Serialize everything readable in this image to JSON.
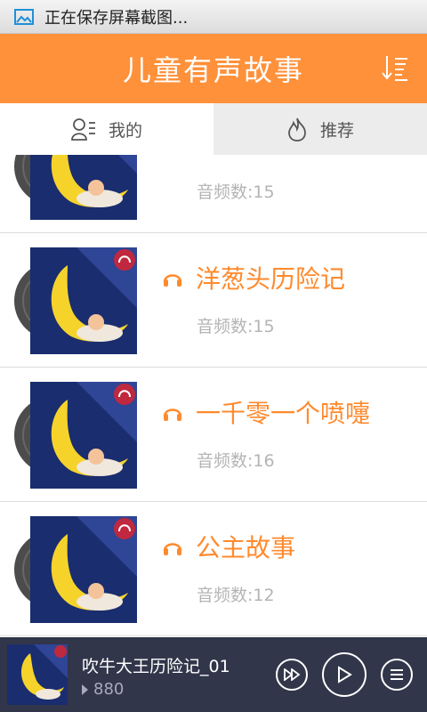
{
  "status_bar": {
    "text": "正在保存屏幕截图...",
    "icon": "image-icon"
  },
  "header": {
    "title": "儿童有声故事",
    "sort_icon": "sort-list-icon",
    "background": "#ff913a"
  },
  "tabs": [
    {
      "label": "我的",
      "icon": "user-list-icon",
      "active": true
    },
    {
      "label": "推荐",
      "icon": "flame-icon",
      "active": false
    }
  ],
  "stories": [
    {
      "title": "",
      "count": "音频数:15"
    },
    {
      "title": "洋葱头历险记",
      "count": "音频数:15"
    },
    {
      "title": "一千零一个喷嚏",
      "count": "音频数:16"
    },
    {
      "title": "公主故事",
      "count": "音频数:12"
    }
  ],
  "player": {
    "title": "吹牛大王历险记_01",
    "plays": "880",
    "controls": [
      "fast-forward-icon",
      "play-icon",
      "menu-icon"
    ]
  },
  "colors": {
    "accent": "#ff8a2d",
    "player_bg": "#32364a",
    "muted": "#b4b4b4"
  }
}
